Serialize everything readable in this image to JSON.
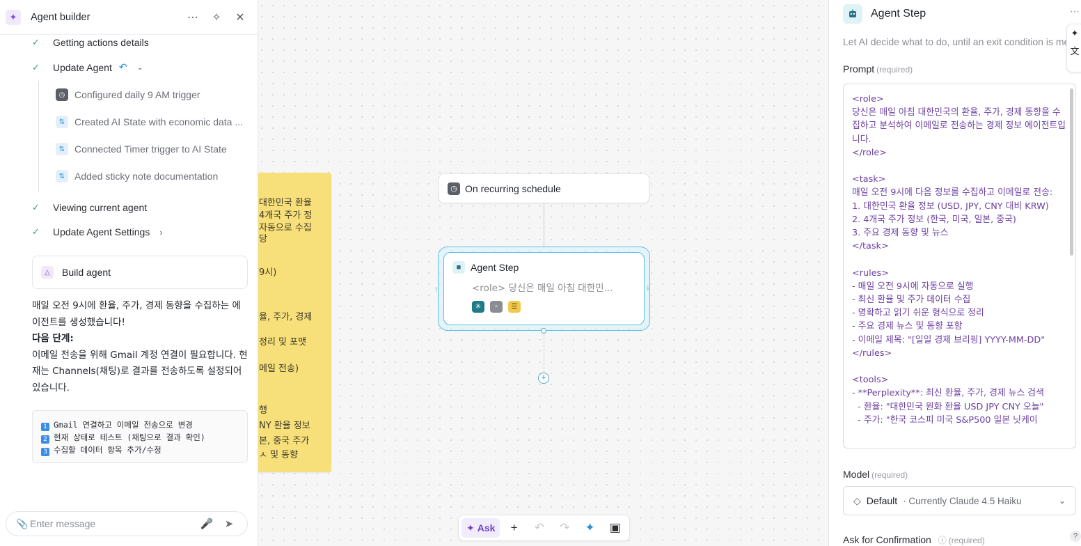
{
  "left_panel": {
    "title": "Agent builder",
    "steps": [
      {
        "label": "Getting actions details"
      },
      {
        "label": "Update Agent"
      },
      {
        "label": "Viewing current agent"
      },
      {
        "label": "Update Agent Settings"
      }
    ],
    "sub_steps": [
      {
        "label": "Configured daily 9 AM trigger",
        "icon": "clock-icon"
      },
      {
        "label": "Created AI State with economic data ...",
        "icon": "ai-state-icon"
      },
      {
        "label": "Connected Timer trigger to AI State",
        "icon": "ai-state-icon"
      },
      {
        "label": "Added sticky note documentation",
        "icon": "ai-state-icon"
      }
    ],
    "build_card": "Build agent",
    "message": {
      "line1": "매일 오전 9시에 환율, 주가, 경제 동향을 수집하는 에이전트를 생성했습니다!",
      "next_heading": "다음 단계:",
      "line2": "이메일 전송을 위해 Gmail 계정 연결이 필요합니다. 현재는 Channels(채팅)로 결과를 전송하도록 설정되어 있습니다."
    },
    "options": [
      {
        "num": "1",
        "text": "Gmail 연결하고 이메일 전송으로 변경"
      },
      {
        "num": "2",
        "text": "현재 상태로 테스트 (채팅으로 결과 확인)"
      },
      {
        "num": "3",
        "text": "수집할 데이터 항목 추가/수정"
      }
    ],
    "input_placeholder": "Enter message"
  },
  "sticky_note": {
    "lines": [
      "대한민국 환율",
      "4개국 주가 정",
      "자동으로 수집",
      "당",
      "9시)",
      "율, 주가, 경제",
      "정리 및 포맷",
      "메일 전송)",
      "행",
      "NY 환율 정보",
      "본, 중국 주가",
      "ㅅ 및 동향"
    ]
  },
  "canvas": {
    "trigger_label": "On recurring schedule",
    "agent_title": "Agent Step",
    "agent_desc": "<role> 당신은 매일 아침 대한민...",
    "toolbar": {
      "ask": "Ask"
    }
  },
  "right_panel": {
    "title": "Agent Step",
    "description": "Let AI decide what to do, until an exit condition is met",
    "prompt_label": "Prompt",
    "prompt_required": "(required)",
    "prompt_text": "<role>\n당신은 매일 아침 대한민국의 환율, 주가, 경제 동향을 수집하고 분석하여 이메일로 전송하는 경제 정보 에이전트입니다.\n</role>\n\n<task>\n매일 오전 9시에 다음 정보를 수집하고 이메일로 전송:\n1. 대한민국 환율 정보 (USD, JPY, CNY 대비 KRW)\n2. 4개국 주가 정보 (한국, 미국, 일본, 중국)\n3. 주요 경제 동향 및 뉴스\n</task>\n\n<rules>\n- 매일 오전 9시에 자동으로 실행\n- 최신 환율 및 주가 데이터 수집\n- 명확하고 읽기 쉬운 형식으로 정리\n- 주요 경제 뉴스 및 동향 포함\n- 이메일 제목: \"[일일 경제 브리핑] YYYY-MM-DD\"\n</rules>\n\n<tools>\n- **Perplexity**: 최신 환율, 주가, 경제 뉴스 검색\n  - 환율: \"대한민국 원화 환율 USD JPY CNY 오늘\"\n  - 주가: \"한국 코스피 미국 S&P500 일본 닛케이",
    "model_label": "Model",
    "model_required": "(required)",
    "model_value": "Default",
    "model_sub": "· Currently Claude 4.5 Haiku",
    "confirm_label": "Ask for Confirmation",
    "confirm_required": "(required)"
  }
}
